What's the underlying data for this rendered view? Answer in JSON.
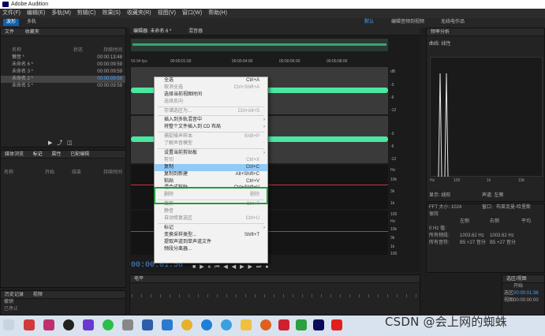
{
  "titlebar": {
    "title": "Adobe Audition"
  },
  "menus": [
    "文件(F)",
    "编辑(E)",
    "多轨(M)",
    "剪辑(C)",
    "效果(S)",
    "收藏夹(R)",
    "视图(V)",
    "窗口(W)",
    "帮助(H)"
  ],
  "toolbar": {
    "waveform": "波形",
    "multitrack": "多轨",
    "default": "默认",
    "edit_audio_video": "编辑音频到视频",
    "radio": "无线电作品"
  },
  "files_panel": {
    "tab_files": "文件",
    "tab_favorites": "收藏夹",
    "col_name": "名称",
    "col_status": "状态",
    "col_duration": "持续时间",
    "items": [
      {
        "name": "懒音 *",
        "duration": "00:00:13:48"
      },
      {
        "name": "未命名 6 *",
        "duration": "00:00:09:59"
      },
      {
        "name": "未命名 3 *",
        "duration": "00:00:09:59"
      },
      {
        "name": "未命名 2 *",
        "duration": "00:00:09:59"
      },
      {
        "name": "未命名 5 *",
        "duration": "00:00:09:59"
      }
    ]
  },
  "markers_panel": {
    "tab_media": "媒体浏览",
    "tab_markers": "标记",
    "tab_props": "属性",
    "tab_registered": "已配编辑",
    "col_name": "名称",
    "col_start": "开始",
    "col_end": "结束",
    "col_duration": "持续时间"
  },
  "history_panel": {
    "tab_history": "历史记录",
    "tab_video": "视频",
    "item": "撤销",
    "status": "已停止"
  },
  "editor": {
    "tab_editor": "编辑器: 未命名 6 *",
    "tab_mixer": "混音器",
    "fps": "59.94 fps",
    "timecodes": [
      "00:00:01:00",
      "00:00:04:00",
      "00:00:06:00",
      "00:00:08:00"
    ],
    "current_time": "00:00:01:36",
    "level_label": "电平",
    "db_ticks": [
      "dB",
      "-3",
      "-6",
      "-12",
      "-3",
      "-6",
      "-12",
      "Hz",
      "10k",
      "3k",
      "1k",
      "100",
      "Hz",
      "10k",
      "3k",
      "1k",
      "100"
    ]
  },
  "context_menu": {
    "items": [
      {
        "label": "全选",
        "shortcut": "Ctrl+A",
        "disabled": false
      },
      {
        "label": "取消全选",
        "shortcut": "Ctrl+Shift+A",
        "disabled": true
      },
      {
        "label": "选择当前视图时间",
        "shortcut": "",
        "disabled": false
      },
      {
        "label": "选择反向",
        "shortcut": "",
        "disabled": true
      },
      {
        "sep": true
      },
      {
        "label": "存储选区为...",
        "shortcut": "Ctrl+Alt+S",
        "disabled": true
      },
      {
        "sep": true
      },
      {
        "label": "插入到多轨混音中",
        "shortcut": "",
        "disabled": false,
        "submenu": true
      },
      {
        "label": "将整个文件插入到 CD 布局",
        "shortcut": "",
        "disabled": false,
        "submenu": true
      },
      {
        "sep": true
      },
      {
        "label": "捕捉噪声样本",
        "shortcut": "Shift+P",
        "disabled": true
      },
      {
        "label": "了解声音模型",
        "shortcut": "",
        "disabled": true
      },
      {
        "sep": true
      },
      {
        "label": "设置当前剪贴板",
        "shortcut": "",
        "disabled": false,
        "submenu": true
      },
      {
        "label": "剪切",
        "shortcut": "Ctrl+X",
        "disabled": true
      },
      {
        "label": "复制",
        "shortcut": "Ctrl+C",
        "disabled": false,
        "highlighted": true
      },
      {
        "label": "复制到新建",
        "shortcut": "Alt+Shift+C",
        "disabled": false
      },
      {
        "label": "粘贴",
        "shortcut": "Ctrl+V",
        "disabled": false
      },
      {
        "label": "混合式粘贴...",
        "shortcut": "Ctrl+Shift+V",
        "disabled": false
      },
      {
        "label": "删除",
        "shortcut": "删除",
        "disabled": true
      },
      {
        "sep": true
      },
      {
        "label": "裁剪",
        "shortcut": "Ctrl+T",
        "disabled": true
      },
      {
        "label": "静音",
        "shortcut": "",
        "disabled": true
      },
      {
        "label": "自动修复选区",
        "shortcut": "Ctrl+U",
        "disabled": true
      },
      {
        "sep": true
      },
      {
        "label": "标记",
        "shortcut": "",
        "disabled": false,
        "submenu": true
      },
      {
        "label": "变换采样类型...",
        "shortcut": "Shift+T",
        "disabled": false
      },
      {
        "label": "提取声道到单声道文件",
        "shortcut": "",
        "disabled": false
      },
      {
        "label": "频段分离器...",
        "shortcut": "",
        "disabled": false
      }
    ]
  },
  "spectrum_panel": {
    "title": "频率分析",
    "shape_label": "曲线:",
    "shape_value": "线性",
    "x_ticks": [
      "Hz",
      "100",
      "1k",
      "10k"
    ],
    "display_label": "显示:",
    "display_value": "线形",
    "channel_label": "声道:",
    "channel_value": "左侧",
    "fft_label": "FFT 大小:",
    "fft_value": "1024",
    "window_label": "窗口:",
    "window_value": "布莱克曼-哈里斯",
    "hold_label": "保持",
    "col_left": "左侧",
    "col_right": "右侧",
    "col_avg": "平均",
    "rows": [
      {
        "label": "0 Hz 值:",
        "l": "",
        "r": ""
      },
      {
        "label": "所有频段:",
        "l": "1003.62 Hz",
        "r": "1003.62 Hz"
      },
      {
        "label": "所有音符:",
        "l": "B5 +27 音分",
        "r": "B5 +27 音分"
      }
    ]
  },
  "selection_panel": {
    "title": "选区/视图",
    "col_start": "开始",
    "row_selection": "选区",
    "row_view": "视图",
    "sel_value": "00:00:01:36",
    "view_value": "00:00:00:00"
  },
  "watermark": "CSDN @会上网的蜘蛛",
  "colors": {
    "accent": "#0d5fb3",
    "waveform": "#4be6a0",
    "highlight": "#91c9f7",
    "green_box": "#1f9d3a",
    "marker": "#c3363a"
  },
  "taskbar_icons": [
    "start-icon",
    "search-icon",
    "taskview-icon",
    "security-icon",
    "wechat-icon",
    "qq-icon",
    "explorer-icon",
    "media-icon",
    "chrome-icon",
    "edge-icon",
    "ie-icon",
    "folder-icon",
    "firefox-icon",
    "music-icon",
    "photos-icon",
    "tool-icon",
    "audition-icon",
    "wps-icon"
  ]
}
